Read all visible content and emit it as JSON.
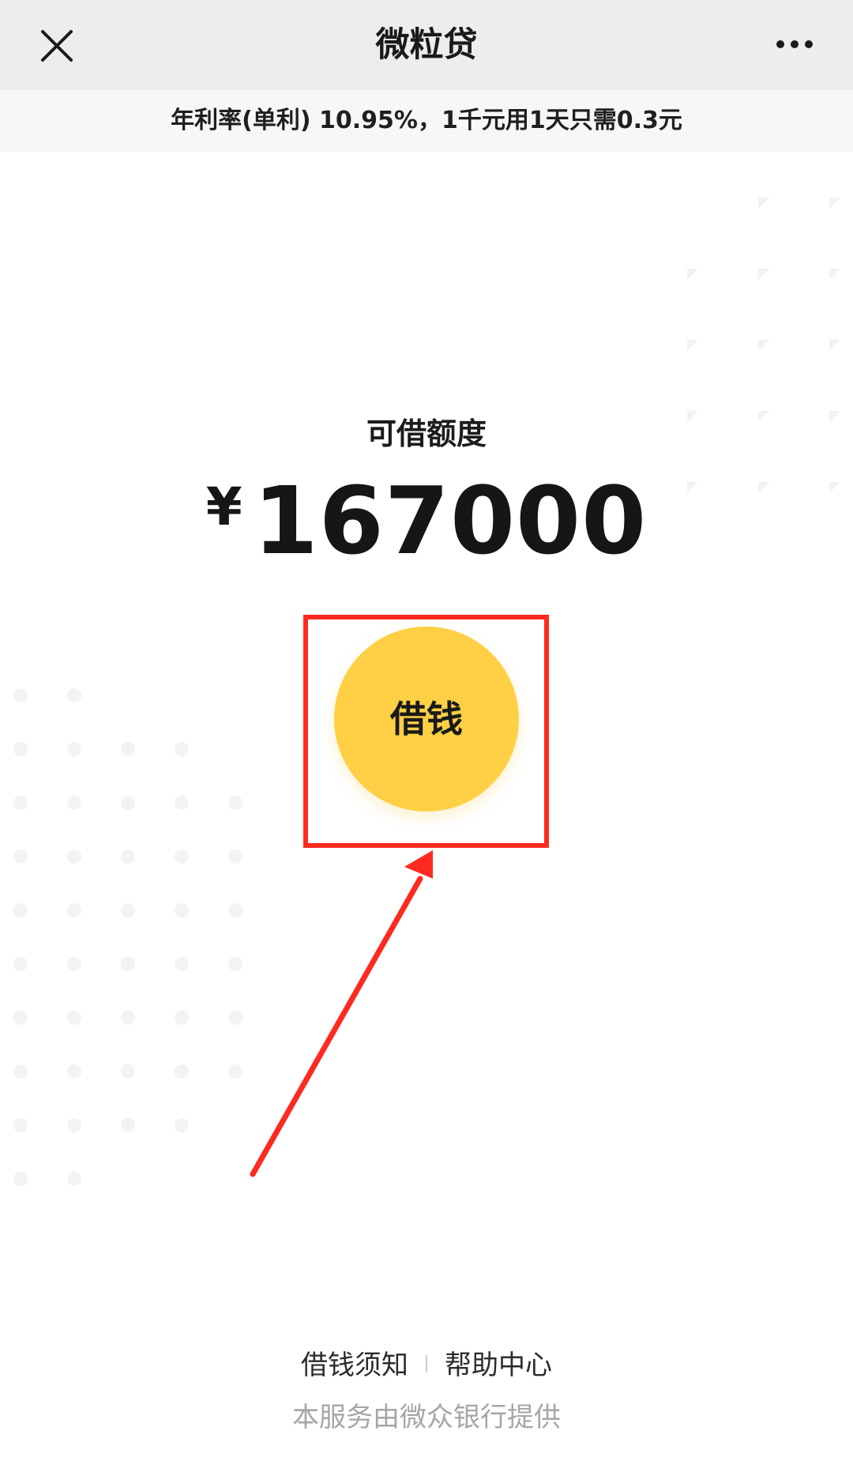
{
  "nav": {
    "title": "微粒贷",
    "close_icon": "close-icon",
    "more_icon": "more-icon"
  },
  "notice": {
    "text": "年利率(单利) 10.95%，1千元用1天只需0.3元"
  },
  "credit": {
    "label": "可借额度",
    "currency": "¥",
    "amount": "167000"
  },
  "borrow_button": {
    "label": "借钱",
    "color": "#ffd045"
  },
  "annotation": {
    "color": "#ff2a1f"
  },
  "footer": {
    "links": [
      "借钱须知",
      "帮助中心"
    ],
    "provider": "本服务由微众银行提供"
  }
}
